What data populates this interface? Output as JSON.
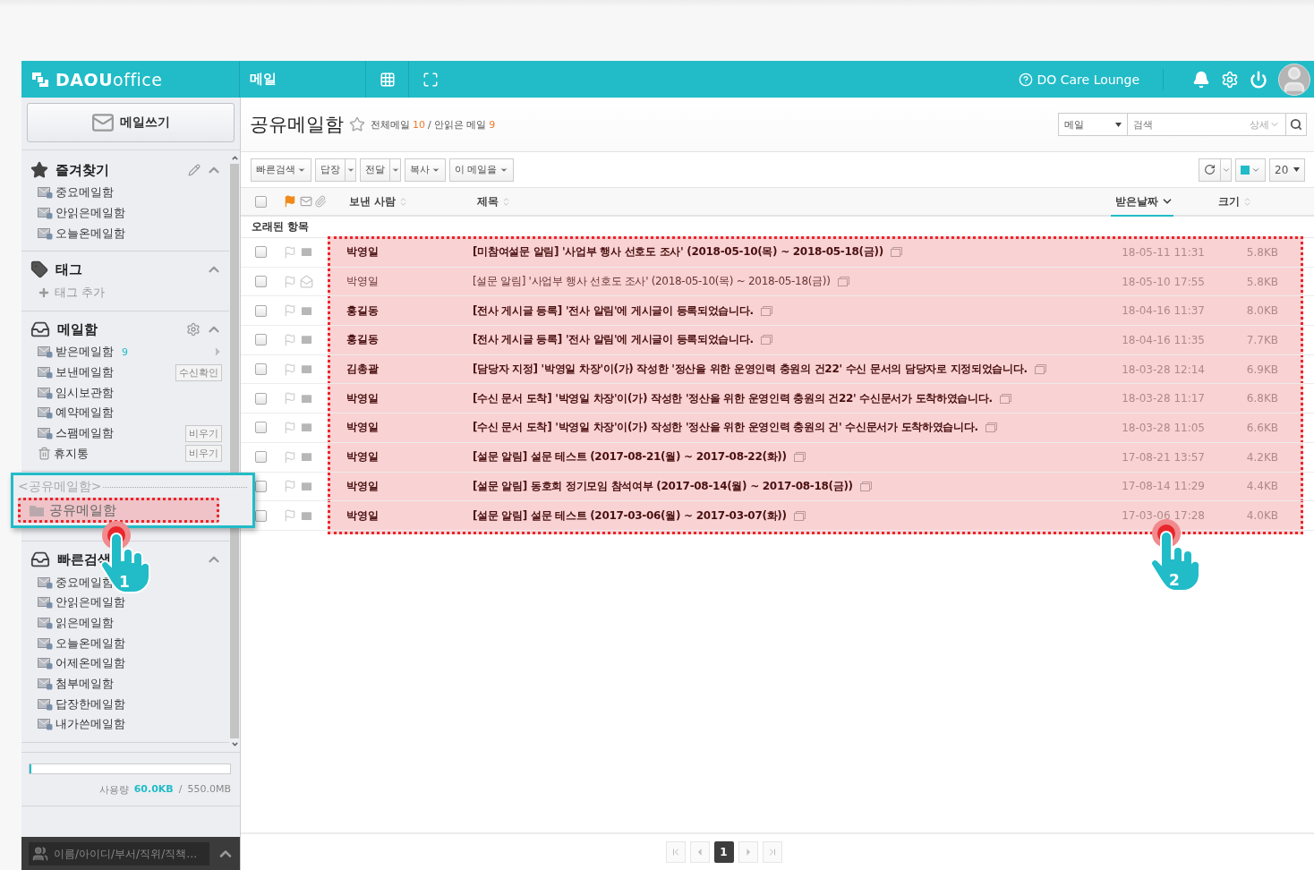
{
  "header": {
    "logo_bold": "DAOU",
    "logo_light": "office",
    "app_title": "메일",
    "help_link": "DO Care Lounge"
  },
  "compose_button": "메일쓰기",
  "sidebar": {
    "sections": [
      {
        "title": "즐겨찾기",
        "kind": "favorites",
        "expanded": true,
        "items": [
          {
            "label": "중요메일함"
          },
          {
            "label": "안읽은메일함"
          },
          {
            "label": "오늘온메일함"
          }
        ]
      },
      {
        "title": "태그",
        "kind": "tags",
        "expanded": true,
        "add_label": "태그 추가"
      },
      {
        "title": "메일함",
        "kind": "mailbox",
        "expanded": true,
        "items": [
          {
            "label": "받은메일함",
            "count": "9"
          },
          {
            "label": "보낸메일함",
            "action": "수신확인"
          },
          {
            "label": "임시보관함"
          },
          {
            "label": "예약메일함"
          },
          {
            "label": "스팸메일함",
            "action": "비우기"
          },
          {
            "label": "휴지통",
            "action": "비우기",
            "kind": "trash"
          }
        ]
      },
      {
        "title": "빠른검색",
        "kind": "search",
        "expanded": true,
        "items": [
          {
            "label": "중요메일함"
          },
          {
            "label": "안읽은메일함"
          },
          {
            "label": "읽은메일함"
          },
          {
            "label": "오늘온메일함"
          },
          {
            "label": "어제온메일함"
          },
          {
            "label": "첨부메일함"
          },
          {
            "label": "답장한메일함"
          },
          {
            "label": "내가쓴메일함"
          }
        ]
      }
    ]
  },
  "storage": {
    "label": "사용량",
    "used": "60.0KB",
    "separator": "/",
    "total": "550.0MB",
    "level": 0.01
  },
  "people_search": {
    "placeholder": "이름/아이디/부서/직위/직책…"
  },
  "mailbox": {
    "title": "공유메일함",
    "total_label": "전체메일",
    "total": "10",
    "separator": "/",
    "unread_label": "안읽은 메일",
    "unread": "9"
  },
  "search": {
    "scope": "메일",
    "placeholder": "검색",
    "detail": "상세"
  },
  "toolbar": {
    "buttons": [
      {
        "label": "빠른검색",
        "split": false
      },
      {
        "label": "답장",
        "split": true
      },
      {
        "label": "전달",
        "split": true
      },
      {
        "label": "복사",
        "split": false
      },
      {
        "label": "이 메일을",
        "split": false
      }
    ],
    "page_size": "20"
  },
  "columns": [
    {
      "label": "보낸 사람",
      "sorted": false
    },
    {
      "label": "제목",
      "sorted": false
    },
    {
      "label": "받은날짜",
      "sorted": true
    },
    {
      "label": "크기",
      "sorted": false
    }
  ],
  "select_all_checked": false,
  "group_label": "오래된 항목",
  "rows": [
    {
      "sender": "박영일",
      "subject": "[미참여설문 알림] '사업부 행사 선호도 조사' (2018-05-10(목) ~ 2018-05-18(금))",
      "date": "18-05-11 11:31",
      "size": "5.8KB",
      "unread": true,
      "checked": false
    },
    {
      "sender": "박영일",
      "subject": "[설문 알림] '사업부 행사 선호도 조사' (2018-05-10(목) ~ 2018-05-18(금))",
      "date": "18-05-10 17:55",
      "size": "5.8KB",
      "unread": false,
      "checked": false
    },
    {
      "sender": "홍길동",
      "subject": "[전사 게시글 등록] '전사 알림'에 게시글이 등록되었습니다.",
      "date": "18-04-16 11:37",
      "size": "8.0KB",
      "unread": true,
      "checked": false
    },
    {
      "sender": "홍길동",
      "subject": "[전사 게시글 등록] '전사 알림'에 게시글이 등록되었습니다.",
      "date": "18-04-16 11:35",
      "size": "7.7KB",
      "unread": true,
      "checked": false
    },
    {
      "sender": "김총괄",
      "subject": "[담당자 지정] '박영일 차장'이(가) 작성한 '정산을 위한 운영인력 충원의 건22' 수신 문서의 담당자로 지정되었습니다.",
      "date": "18-03-28 12:14",
      "size": "6.9KB",
      "unread": true,
      "checked": false
    },
    {
      "sender": "박영일",
      "subject": "[수신 문서 도착] '박영일 차장'이(가) 작성한 '정산을 위한 운영인력 충원의 건22' 수신문서가 도착하였습니다.",
      "date": "18-03-28 11:17",
      "size": "6.8KB",
      "unread": true,
      "checked": false
    },
    {
      "sender": "박영일",
      "subject": "[수신 문서 도착] '박영일 차장'이(가) 작성한 '정산을 위한 운영인력 충원의 건' 수신문서가 도착하였습니다.",
      "date": "18-03-28 11:05",
      "size": "6.6KB",
      "unread": true,
      "checked": false
    },
    {
      "sender": "박영일",
      "subject": "[설문 알림] 설문 테스트 (2017-08-21(월) ~ 2017-08-22(화))",
      "date": "17-08-21 13:57",
      "size": "4.2KB",
      "unread": true,
      "checked": false
    },
    {
      "sender": "박영일",
      "subject": "[설문 알림] 동호회 정기모임 참석여부 (2017-08-14(월) ~ 2017-08-18(금))",
      "date": "17-08-14 11:29",
      "size": "4.4KB",
      "unread": true,
      "checked": false
    },
    {
      "sender": "박영일",
      "subject": "[설문 알림] 설문 테스트 (2017-03-06(월) ~ 2017-03-07(화))",
      "date": "17-03-06 17:28",
      "size": "4.0KB",
      "unread": true,
      "checked": false
    }
  ],
  "pagination": {
    "pages": [
      {
        "label": "1",
        "selected": true
      }
    ]
  },
  "callout": {
    "heading": "<공유메일함>",
    "item": "공유메일함"
  },
  "steps": [
    {
      "number": "1"
    },
    {
      "number": "2"
    }
  ]
}
